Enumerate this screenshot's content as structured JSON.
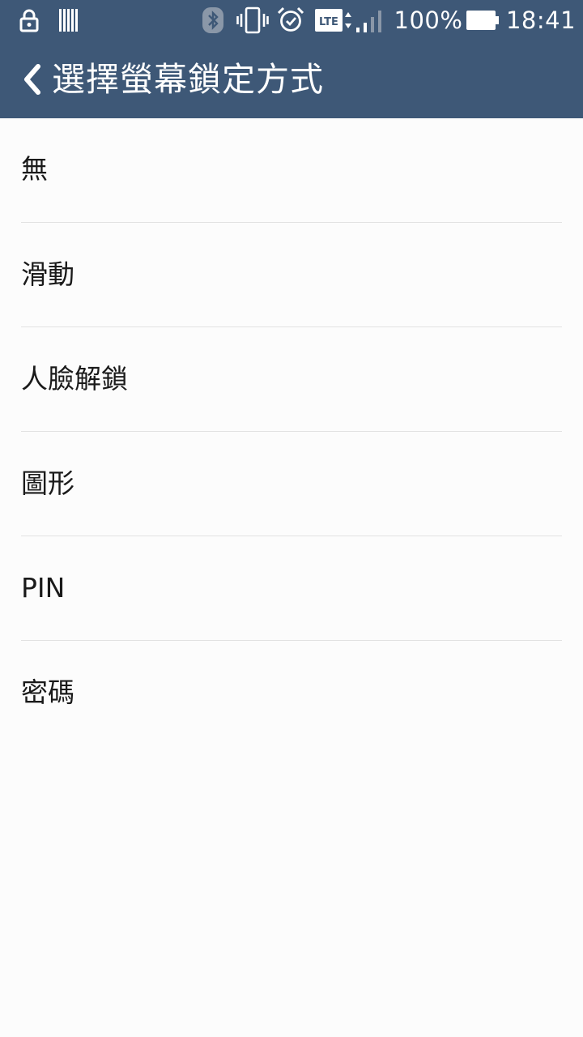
{
  "status_bar": {
    "battery_percent": "100%",
    "time": "18:41",
    "network_type": "LTE",
    "icons": [
      "lock-icon",
      "barcode-icon",
      "bluetooth-icon",
      "vibrate-icon",
      "alarm-icon",
      "lte-icon",
      "signal-icon",
      "battery-icon"
    ]
  },
  "app_bar": {
    "title": "選擇螢幕鎖定方式",
    "back_icon": "chevron-left-icon"
  },
  "lock_options": [
    {
      "label": "無"
    },
    {
      "label": "滑動"
    },
    {
      "label": "人臉解鎖"
    },
    {
      "label": "圖形"
    },
    {
      "label": "PIN"
    },
    {
      "label": "密碼"
    }
  ],
  "colors": {
    "header_bg": "#3e5877",
    "list_bg": "#fcfcfc",
    "divider": "#e2e2e2",
    "text": "#1a1a1a"
  }
}
